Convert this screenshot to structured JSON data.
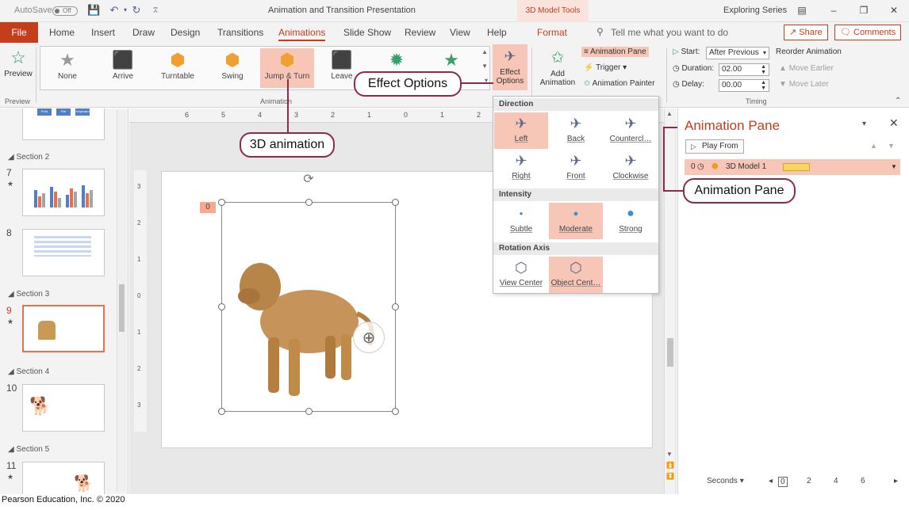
{
  "window": {
    "autosave_label": "AutoSave",
    "autosave_state": "Off",
    "title": "Animation and Transition Presentation",
    "contextual_tab": "3D Model Tools",
    "user_label": "Exploring Series"
  },
  "tabs": [
    "File",
    "Home",
    "Insert",
    "Draw",
    "Design",
    "Transitions",
    "Animations",
    "Slide Show",
    "Review",
    "View",
    "Help",
    "Format"
  ],
  "tell_me_placeholder": "Tell me what you want to do",
  "share_label": "Share",
  "comments_label": "Comments",
  "ribbon": {
    "preview_label": "Preview",
    "preview_group": "Preview",
    "animation_group": "Animation",
    "timing_group": "Timing",
    "gallery": [
      "None",
      "Arrive",
      "Turntable",
      "Swing",
      "Jump & Turn",
      "Leave",
      "",
      ""
    ],
    "effect_options_line1": "Effect",
    "effect_options_line2": "Options",
    "add_animation_line1": "Add",
    "add_animation_line2": "Animation",
    "animation_pane_cmd": "Animation Pane",
    "trigger_cmd": "Trigger",
    "animation_painter_cmd": "Animation Painter",
    "start_label": "Start:",
    "start_value": "After Previous",
    "duration_label": "Duration:",
    "duration_value": "02.00",
    "delay_label": "Delay:",
    "delay_value": "00.00",
    "reorder_label": "Reorder Animation",
    "move_earlier": "Move Earlier",
    "move_later": "Move Later"
  },
  "thumbnails": {
    "sections": [
      "Section 2",
      "Section 3",
      "Section 4",
      "Section 5"
    ],
    "slide_numbers": [
      "7",
      "8",
      "9",
      "10",
      "11"
    ],
    "slide1_boxes": [
      "Print",
      "File",
      "Keyboard"
    ]
  },
  "hruler_ticks": [
    "6",
    "5",
    "4",
    "3",
    "2",
    "1",
    "0",
    "1",
    "2"
  ],
  "vruler_ticks": [
    "3",
    "2",
    "1",
    "0",
    "1",
    "2",
    "3"
  ],
  "slide": {
    "badge": "0"
  },
  "effect_menu": {
    "direction_head": "Direction",
    "intensity_head": "Intensity",
    "rotation_head": "Rotation Axis",
    "direction": [
      "Left",
      "Back",
      "Countercl…",
      "Right",
      "Front",
      "Clockwise"
    ],
    "intensity": [
      "Subtle",
      "Moderate",
      "Strong"
    ],
    "rotation": [
      "View Center",
      "Object Cent…"
    ]
  },
  "anim_pane": {
    "title": "Animation Pane",
    "play_from": "Play From",
    "row_index": "0",
    "row_label": "3D Model 1",
    "seconds_label": "Seconds",
    "time_ticks": [
      "0",
      "2",
      "4",
      "6"
    ]
  },
  "callouts": {
    "effect_options": "Effect Options",
    "animation_3d": "3D animation",
    "animation_pane": "Animation Pane"
  },
  "credit": "Pearson Education, Inc. © 2020"
}
